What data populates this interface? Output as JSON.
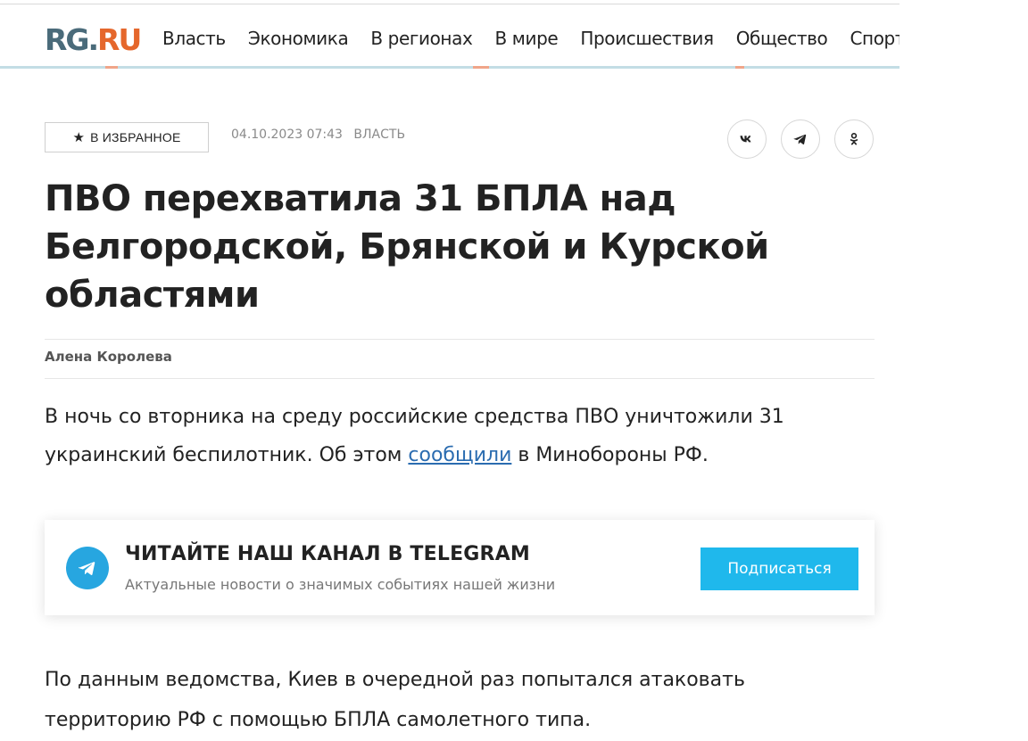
{
  "header": {
    "logo_rg": "RG",
    "logo_ru": "RU",
    "nav": [
      "Власть",
      "Экономика",
      "В регионах",
      "В мире",
      "Происшествия",
      "Общество",
      "Спорт"
    ]
  },
  "article_meta": {
    "favorite_label": "В ИЗБРАННОЕ",
    "datetime": "04.10.2023 07:43",
    "section": "ВЛАСТЬ"
  },
  "share": {
    "vk_icon": "vk-icon",
    "telegram_icon": "telegram-icon",
    "ok_icon": "odnoklassniki-icon"
  },
  "article": {
    "title": "ПВО перехватила 31 БПЛА над Белгородской, Брянской и Курской областями",
    "author": "Алена Королева",
    "lead_before": "В ночь со вторника на среду российские средства ПВО уничтожили 31 украинский беспилотник. Об этом ",
    "lead_link": "сообщили",
    "lead_after": " в Минобороны РФ.",
    "body": "По данным ведомства, Киев в очередной раз попытался атаковать территорию РФ с помощью БПЛА самолетного типа."
  },
  "telegram_promo": {
    "title": "ЧИТАЙТЕ НАШ КАНАЛ В TELEGRAM",
    "subtitle": "Актуальные новости о значимых событиях нашей жизни",
    "button": "Подписаться"
  },
  "colors": {
    "logo_rg": "#4a6b7a",
    "logo_ru": "#e5672c",
    "link": "#2b6cb0",
    "telegram": "#27a6e0",
    "subscribe_button": "#1fb8ec"
  }
}
